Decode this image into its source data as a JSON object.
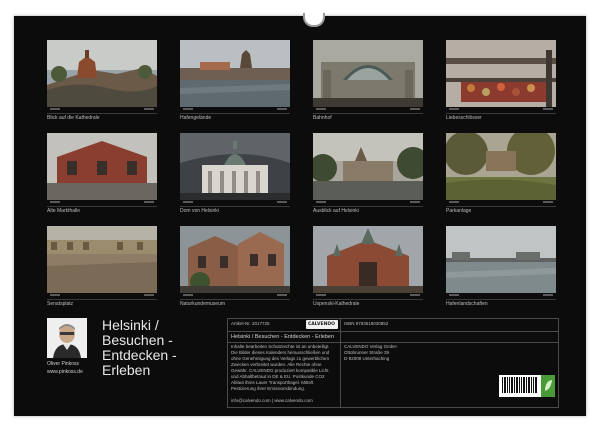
{
  "calendar": {
    "title": "Helsinki / Besuchen - Entdecken - Erleben",
    "title_lines": [
      "Helsinki /",
      "Besuchen -",
      "Entdecken -",
      "Erleben"
    ],
    "author_name": "Oliver Pinkoss",
    "author_web": "www.pinkoss.de"
  },
  "months": [
    {
      "caption": "Blick auf die Kathedrale"
    },
    {
      "caption": "Hafengelände"
    },
    {
      "caption": "Bahnhof"
    },
    {
      "caption": "Liebesschlösser"
    },
    {
      "caption": "Alte Markthalle"
    },
    {
      "caption": "Dom von Helsinki"
    },
    {
      "caption": "Ausblick auf Helsinki"
    },
    {
      "caption": "Parkanlage"
    },
    {
      "caption": "Senatsplatz"
    },
    {
      "caption": "Naturkundemuseum"
    },
    {
      "caption": "Uspenski-Kathedrale"
    },
    {
      "caption": "Hafenlandschaften"
    }
  ],
  "info": {
    "article_no": "Artikel-Nr. 2017725",
    "calvendo_label": "CALVENDO",
    "isbn": "ISBN 9783518030852",
    "publisher_lines": [
      "CALVENDO Verlag GmbH",
      "Ottobrunner Straße 39",
      "D-82008 Unterhaching"
    ],
    "subtitle": "Helsinki / Besuchen - Entdecken - Erleben",
    "description": "Inhalte bearbeiten Schutzrechte ist an unbeteiligt. Die Bilder dieses Kalenders herausschließen und ohne Genehmigung des Verlags zu gewerblichen Zwecken verbreitet wurden. Alle Rechte ohne Gewähr. CALVENDO produziert kompatible Licht und Abhaltbetraut in DE & EU. Postkunde CO2 Ablaut ihres Lauer Transporthagel. Mittelt Pestizierung ihrer Emissionsbindung.",
    "email": "info@calvendo.com | www.calvendo.com"
  },
  "colors": {
    "sheet": "#0c0c0c",
    "text": "#bdbdbd",
    "title": "#e8e8e8"
  }
}
